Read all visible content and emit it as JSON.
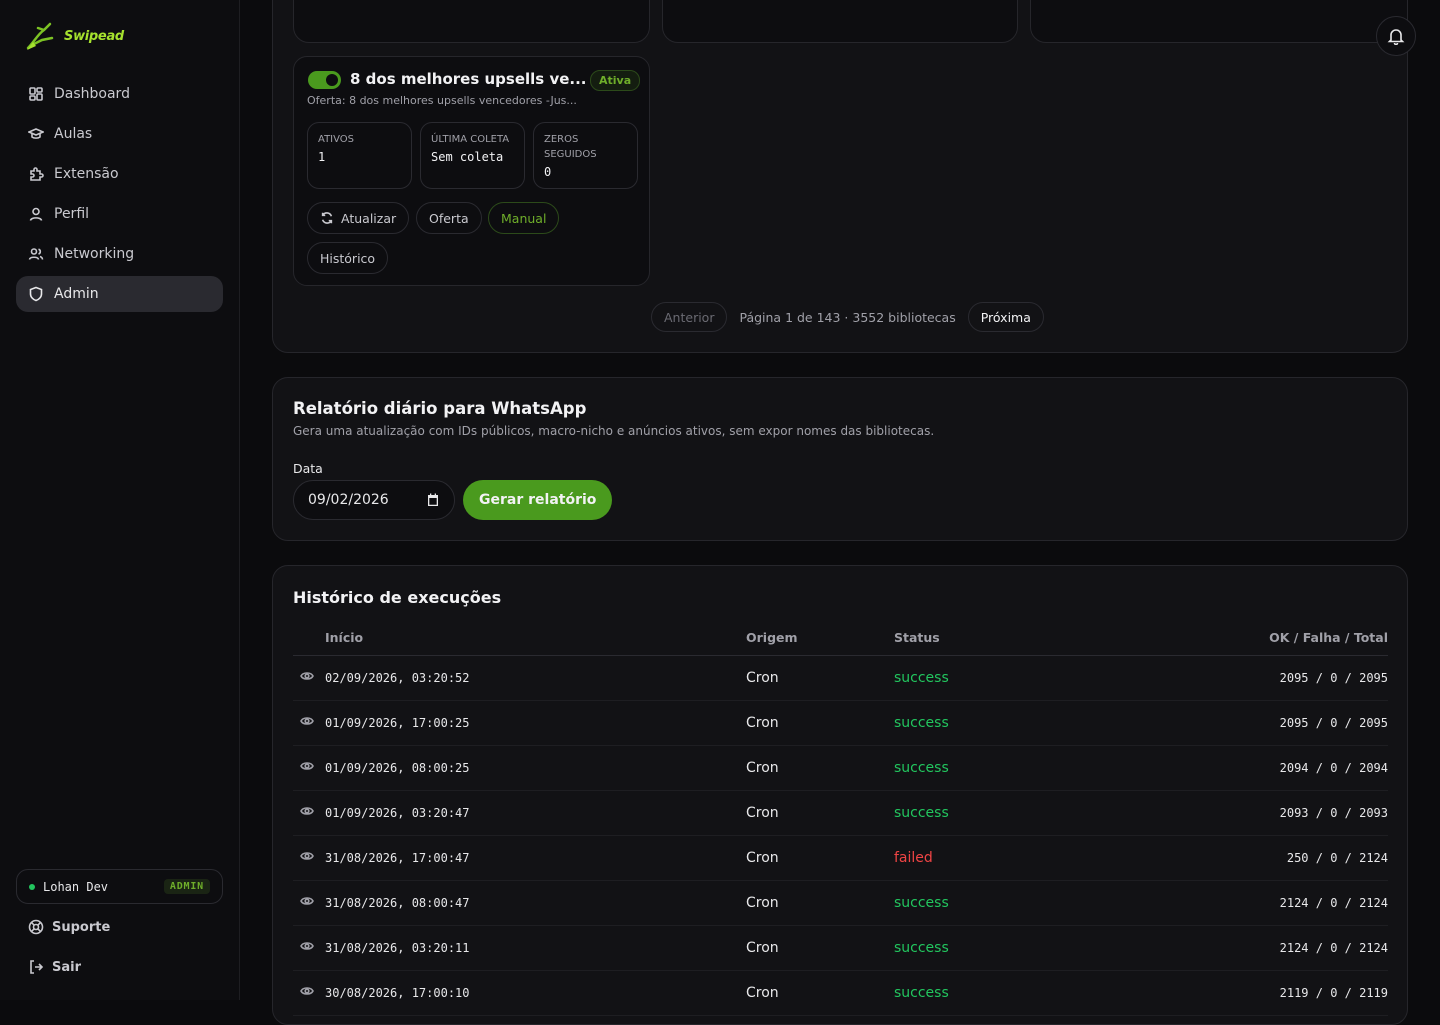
{
  "app": {
    "logo_text": "Swipead"
  },
  "sidebar": {
    "items": [
      {
        "label": "Dashboard",
        "icon": "grid-icon"
      },
      {
        "label": "Aulas",
        "icon": "graduation-cap-icon"
      },
      {
        "label": "Extensão",
        "icon": "puzzle-icon"
      },
      {
        "label": "Perfil",
        "icon": "user-icon"
      },
      {
        "label": "Networking",
        "icon": "users-icon"
      },
      {
        "label": "Admin",
        "icon": "shield-icon",
        "active": true
      }
    ],
    "user": {
      "name": "Lohan Dev",
      "badge": "ADMIN"
    },
    "support_label": "Suporte",
    "logout_label": "Sair"
  },
  "library_card": {
    "title": "8 dos melhores upsells ve...",
    "status": "Ativa",
    "offer": "Oferta: 8 dos melhores upsells vencedores -Jus...",
    "stats": [
      {
        "label": "ATIVOS",
        "value": "1"
      },
      {
        "label": "ÚLTIMA COLETA",
        "value": "Sem coleta"
      },
      {
        "label": "ZEROS SEGUIDOS",
        "value": "0"
      }
    ],
    "actions": {
      "update": "Atualizar",
      "offer": "Oferta",
      "manual": "Manual",
      "history": "Histórico"
    }
  },
  "pagination": {
    "prev": "Anterior",
    "info": "Página 1 de 143 · 3552 bibliotecas",
    "next": "Próxima"
  },
  "report": {
    "title": "Relatório diário para WhatsApp",
    "description": "Gera uma atualização com IDs públicos, macro-nicho e anúncios ativos, sem expor nomes das bibliotecas.",
    "date_label": "Data",
    "date_value": "09/02/2026",
    "button": "Gerar relatório"
  },
  "history": {
    "title": "Histórico de execuções",
    "columns": {
      "start": "Início",
      "origin": "Origem",
      "status": "Status",
      "totals": "OK / Falha / Total"
    },
    "rows": [
      {
        "start": "02/09/2026, 03:20:52",
        "origin": "Cron",
        "status": "success",
        "totals": "2095 / 0 / 2095"
      },
      {
        "start": "01/09/2026, 17:00:25",
        "origin": "Cron",
        "status": "success",
        "totals": "2095 / 0 / 2095"
      },
      {
        "start": "01/09/2026, 08:00:25",
        "origin": "Cron",
        "status": "success",
        "totals": "2094 / 0 / 2094"
      },
      {
        "start": "01/09/2026, 03:20:47",
        "origin": "Cron",
        "status": "success",
        "totals": "2093 / 0 / 2093"
      },
      {
        "start": "31/08/2026, 17:00:47",
        "origin": "Cron",
        "status": "failed",
        "totals": "250 / 0 / 2124"
      },
      {
        "start": "31/08/2026, 08:00:47",
        "origin": "Cron",
        "status": "success",
        "totals": "2124 / 0 / 2124"
      },
      {
        "start": "31/08/2026, 03:20:11",
        "origin": "Cron",
        "status": "success",
        "totals": "2124 / 0 / 2124"
      },
      {
        "start": "30/08/2026, 17:00:10",
        "origin": "Cron",
        "status": "success",
        "totals": "2119 / 0 / 2119"
      }
    ]
  },
  "colors": {
    "accent": "#4a9a1e",
    "success": "#22c55e",
    "failed": "#ef4444",
    "background": "#0b0b0d"
  }
}
